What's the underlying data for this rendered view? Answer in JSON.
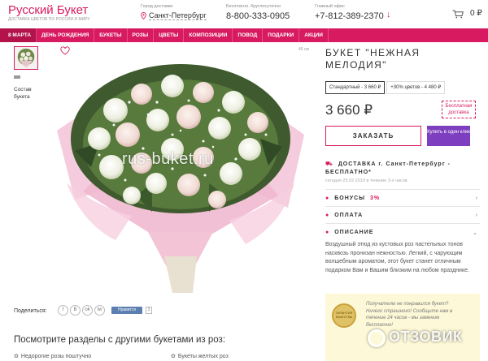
{
  "header": {
    "logo": "Русский Букет",
    "tagline": "ДОСТАВКА ЦВЕТОВ ПО РОССИИ И МИРУ",
    "city_caption": "Город доставки",
    "city": "Санкт-Петербург",
    "free_phone_caption": "Бесплатно. Круглосуточно",
    "free_phone": "8-800-333-0905",
    "office_caption": "Главный офис",
    "office_phone": "+7-812-389-2370",
    "cart_count": "0 ₽"
  },
  "nav": {
    "items": [
      "8 МАРТА",
      "ДЕНЬ РОЖДЕНИЯ",
      "БУКЕТЫ",
      "РОЗЫ",
      "ЦВЕТЫ",
      "КОМПОЗИЦИИ",
      "ПОВОД",
      "ПОДАРКИ",
      "АКЦИИ"
    ]
  },
  "gallery": {
    "caption": "Состав букета",
    "size_label": "46 см",
    "watermark": "rus-buket.ru"
  },
  "share": {
    "label": "Поделиться:",
    "icons": [
      "f",
      "B",
      "ok",
      "tw"
    ],
    "like_label": "Нравится",
    "like_count": "3"
  },
  "bottom": {
    "title": "Посмотрите разделы с другими букетами из роз:",
    "link1": "Недорогие розы поштучно",
    "link2": "Букеты желтых роз"
  },
  "product": {
    "title": "БУКЕТ \"НЕЖНАЯ МЕЛОДИЯ\"",
    "option1": "Стандартный - 3 660 ₽",
    "option2": "+30% цветов - 4 480 ₽",
    "price": "3 660 ₽",
    "free_delivery": "Бесплатная доставка",
    "order_button": "ЗАКАЗАТЬ",
    "oneclick_button": "Купить в один клик",
    "delivery_title": "ДОСТАВКА г. Санкт-Петербург - БЕСПЛАТНО*",
    "delivery_sub": "сегодня 25.02.2019 в течение 3-х часов",
    "bonus_title": "БОНУСЫ",
    "bonus_pct": "3%",
    "payment_title": "ОПЛАТА",
    "description_title": "ОПИСАНИЕ",
    "description": "Воздушный этюд из кустовых роз пастельных тонов насквозь пронизан нежностью. Легкий, с чарующим волшебным ароматом, этот букет станет отличным подарком Вам и Вашим близким на любом празднике."
  },
  "promo": {
    "badge": "ГАРАНТИЯ КАЧЕСТВА",
    "text": "Получателю не понравился букет? Ничего страшного! Сообщите нам в течение 24 часов - мы заменим бесплатно!"
  },
  "overlay": {
    "brand": "ОТЗОВИК"
  },
  "colors": {
    "accent": "#d81b60",
    "purple": "#7d3fbf"
  }
}
